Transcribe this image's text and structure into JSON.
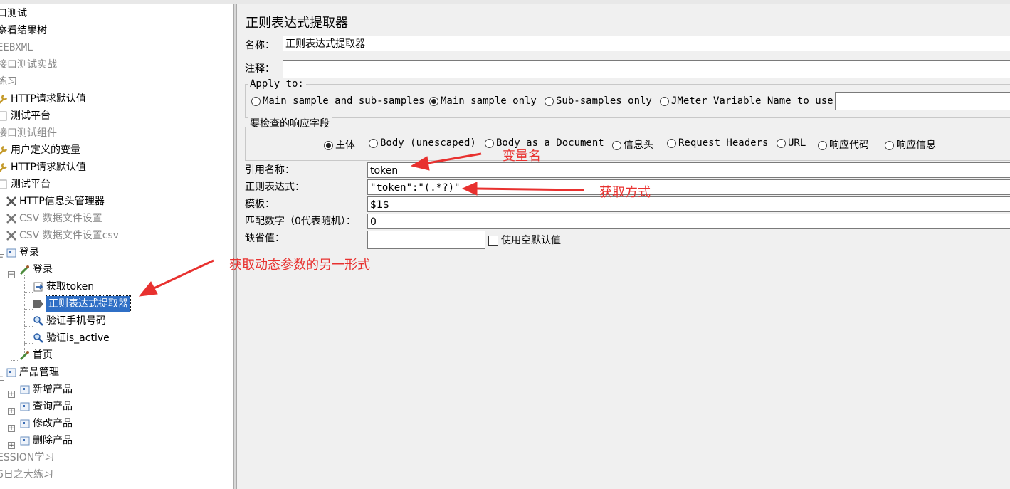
{
  "tree": {
    "nodes": [
      {
        "label": "口测试",
        "icon": "none",
        "disabled": false
      },
      {
        "label": "察看结果树",
        "icon": "none",
        "disabled": false
      },
      {
        "label": "EEBXML",
        "icon": "none",
        "disabled": true
      },
      {
        "label": "接口测试实战",
        "icon": "none",
        "disabled": true
      },
      {
        "label": "练习",
        "icon": "none",
        "disabled": true
      },
      {
        "label": "HTTP请求默认值",
        "icon": "wrench-icon",
        "disabled": false
      },
      {
        "label": "测试平台",
        "icon": "none",
        "disabled": false
      },
      {
        "label": "接口测试组件",
        "icon": "none",
        "disabled": true
      },
      {
        "label": "用户定义的变量",
        "icon": "wrench-icon",
        "disabled": false
      },
      {
        "label": "HTTP请求默认值",
        "icon": "wrench-icon",
        "disabled": false
      },
      {
        "label": "测试平台",
        "icon": "none",
        "disabled": false
      },
      {
        "label": "HTTP信息头管理器",
        "icon": "tools-icon",
        "disabled": false
      },
      {
        "label": "CSV 数据文件设置",
        "icon": "tools-icon",
        "disabled": true
      },
      {
        "label": "CSV 数据文件设置csv",
        "icon": "tools-icon",
        "disabled": true
      },
      {
        "label": "登录",
        "icon": "controller-icon",
        "disabled": false
      },
      {
        "label": "登录",
        "icon": "sampler-icon",
        "disabled": false
      },
      {
        "label": "获取token",
        "icon": "postprocessor-icon",
        "disabled": false
      },
      {
        "label": "正则表达式提取器",
        "icon": "extractor-icon",
        "disabled": false,
        "selected": true
      },
      {
        "label": "验证手机号码",
        "icon": "magnifier-icon",
        "disabled": false
      },
      {
        "label": "验证is_active",
        "icon": "magnifier-icon",
        "disabled": false
      },
      {
        "label": "首页",
        "icon": "sampler-icon",
        "disabled": false
      },
      {
        "label": "产品管理",
        "icon": "controller-icon",
        "disabled": false
      },
      {
        "label": "新增产品",
        "icon": "controller-icon",
        "disabled": false
      },
      {
        "label": "查询产品",
        "icon": "controller-icon",
        "disabled": false
      },
      {
        "label": "修改产品",
        "icon": "controller-icon",
        "disabled": false
      },
      {
        "label": "删除产品",
        "icon": "controller-icon",
        "disabled": false
      },
      {
        "label": "ESSION学习",
        "icon": "none",
        "disabled": true
      },
      {
        "label": "6日之大练习",
        "icon": "none",
        "disabled": true
      }
    ]
  },
  "panel": {
    "title": "正则表达式提取器",
    "name_label": "名称：",
    "name_value": "正则表达式提取器",
    "comment_label": "注释：",
    "comment_value": "",
    "apply_to": {
      "title": "Apply to:",
      "options": [
        "Main sample and sub-samples",
        "Main sample only",
        "Sub-samples only",
        "JMeter Variable Name to use"
      ],
      "selected": "Main sample only",
      "variable_value": ""
    },
    "field_to_check": {
      "title": "要检查的响应字段",
      "options": [
        "主体",
        "Body (unescaped)",
        "Body as a Document",
        "信息头",
        "Request Headers",
        "URL",
        "响应代码",
        "响应信息"
      ],
      "selected": "主体"
    },
    "ref_name_label": "引用名称：",
    "ref_name_value": "token",
    "regex_label": "正则表达式：",
    "regex_value": "\"token\":\"(.*?)\"",
    "template_label": "模板：",
    "template_value": "$1$",
    "match_no_label": "匹配数字（0代表随机）：",
    "match_no_value": "0",
    "default_label": "缺省值：",
    "default_value": "",
    "use_empty_default_label": "使用空默认值",
    "use_empty_default_checked": false
  },
  "annotations": {
    "variable_name": "变量名",
    "extraction_method": "获取方式",
    "alt_form": "获取动态参数的另一形式",
    "color": "#e8312f"
  }
}
